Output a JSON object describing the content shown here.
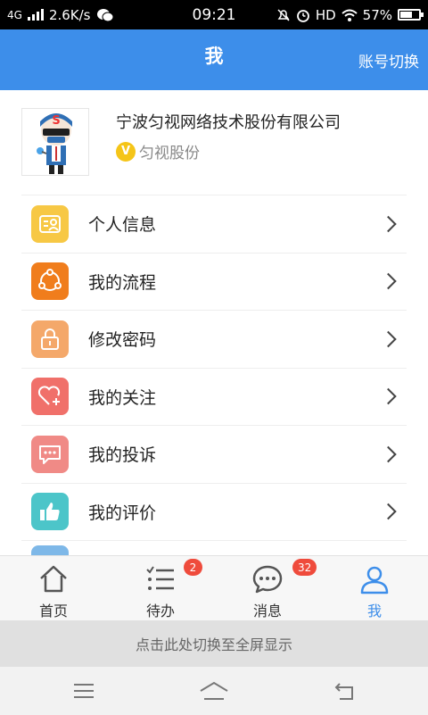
{
  "status_bar": {
    "network": "4G",
    "speed": "2.6K/s",
    "time": "09:21",
    "hd": "HD",
    "battery": "57%",
    "battery_level": 0.57
  },
  "header": {
    "title": "我",
    "switch_account": "账号切换",
    "bg_color": "#3d8eea"
  },
  "profile": {
    "company": "宁波匀视网络技术股份有限公司",
    "badge_letter": "V",
    "short_name": "匀视股份"
  },
  "menu": [
    {
      "label": "个人信息",
      "icon": "id-card-icon",
      "color": "#f7c845"
    },
    {
      "label": "我的流程",
      "icon": "share-nodes-icon",
      "color": "#f07d1c"
    },
    {
      "label": "修改密码",
      "icon": "lock-icon",
      "color": "#f4a86a"
    },
    {
      "label": "我的关注",
      "icon": "heart-plus-icon",
      "color": "#f0706a"
    },
    {
      "label": "我的投诉",
      "icon": "chat-bubble-icon",
      "color": "#f08a86"
    },
    {
      "label": "我的评价",
      "icon": "thumbs-up-icon",
      "color": "#4cc5c9"
    }
  ],
  "tabs": [
    {
      "label": "首页",
      "icon": "home-icon",
      "badge": ""
    },
    {
      "label": "待办",
      "icon": "checklist-icon",
      "badge": "2"
    },
    {
      "label": "消息",
      "icon": "message-icon",
      "badge": "32"
    },
    {
      "label": "我",
      "icon": "user-icon",
      "badge": "",
      "active": true
    }
  ],
  "fullscreen_hint": "点击此处切换至全屏显示",
  "navbar": {
    "buttons": [
      "menu-icon",
      "home-outline-icon",
      "back-icon"
    ]
  }
}
